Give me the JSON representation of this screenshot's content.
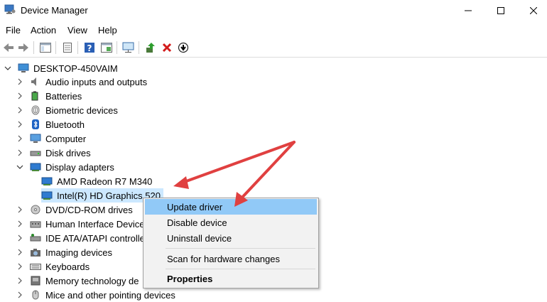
{
  "window": {
    "title": "Device Manager",
    "controls": [
      "minimize",
      "maximize",
      "close"
    ]
  },
  "menu": [
    "File",
    "Action",
    "View",
    "Help"
  ],
  "toolbar": {
    "icons": [
      "back-arrow-icon",
      "forward-arrow-icon",
      "show-hide-tree-icon",
      "properties-icon",
      "help-icon",
      "view-icon",
      "scan-monitor-icon",
      "update-driver-icon",
      "uninstall-x-icon",
      "disable-download-icon"
    ]
  },
  "tree": {
    "root": "DESKTOP-450VAIM",
    "categories": [
      "Audio inputs and outputs",
      "Batteries",
      "Biometric devices",
      "Bluetooth",
      "Computer",
      "Disk drives",
      "Display adapters",
      "DVD/CD-ROM drives",
      "Human Interface Device",
      "IDE ATA/ATAPI controller",
      "Imaging devices",
      "Keyboards",
      "Memory technology de",
      "Mice and other pointing devices"
    ],
    "display_children": [
      "AMD Radeon R7 M340",
      "Intel(R) HD Graphics 520"
    ]
  },
  "context_menu": {
    "items": [
      "Update driver",
      "Disable device",
      "Uninstall device",
      "Scan for hardware changes",
      "Properties"
    ]
  },
  "colors": {
    "selection": "#cce8ff",
    "menu_highlight": "#91c9f7",
    "annotation_arrow": "#e04040"
  }
}
